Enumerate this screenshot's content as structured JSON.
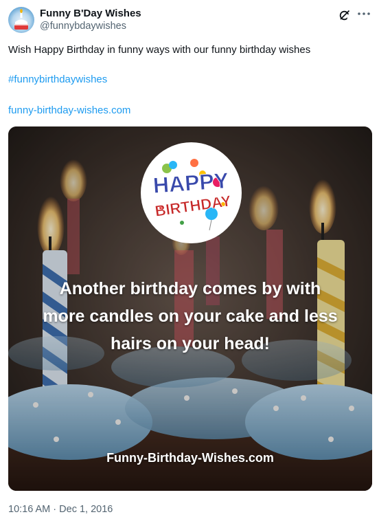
{
  "author": {
    "display_name": "Funny B'Day Wishes",
    "handle": "@funnybdaywishes",
    "avatar_icon": "birthday-cake-icon"
  },
  "actions": {
    "grok_icon": "grok-icon",
    "more_icon": "more-dots-icon"
  },
  "tweet": {
    "text": "Wish Happy Birthday in funny ways with our funny birthday wishes",
    "hashtag": "#funnybirthdaywishes",
    "link": "funny-birthday-wishes.com"
  },
  "media": {
    "logo_line1": "HAPPY",
    "logo_line2": "BIRTHDAY",
    "quote_lines": [
      "Another birthday comes by with",
      "more candles on your cake and less",
      "hairs on your head!"
    ],
    "site_caption": "Funny-Birthday-Wishes.com"
  },
  "timestamp": {
    "time": "10:16 AM",
    "separator": " · ",
    "date": "Dec 1, 2016"
  },
  "colors": {
    "link": "#1d9bf0",
    "text": "#0f1419",
    "secondary": "#536471"
  }
}
